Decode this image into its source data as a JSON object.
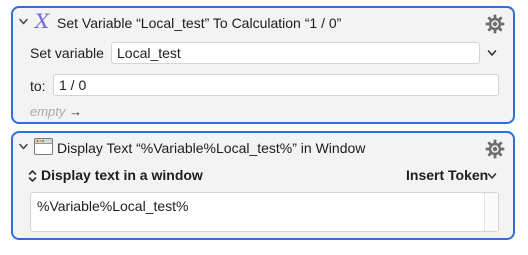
{
  "action1": {
    "title": "Set Variable “Local_test” To Calculation “1 / 0”",
    "icon": "x-variable-icon",
    "set_variable_label": "Set variable",
    "variable_name": "Local_test",
    "to_label": "to:",
    "calculation": "1 / 0",
    "empty_label": "empty",
    "empty_arrow": "→"
  },
  "action2": {
    "title": "Display Text “%Variable%Local_test%” in Window",
    "icon": "window-icon",
    "display_mode": "Display text in a window",
    "display_mode_arrows": "⌃",
    "insert_token_label": "Insert Token",
    "text": "%Variable%Local_test%"
  },
  "colors": {
    "selection_border": "#2f6fdb",
    "action_background": "#f3f3f3",
    "x_icon": "#6a6fd6"
  }
}
